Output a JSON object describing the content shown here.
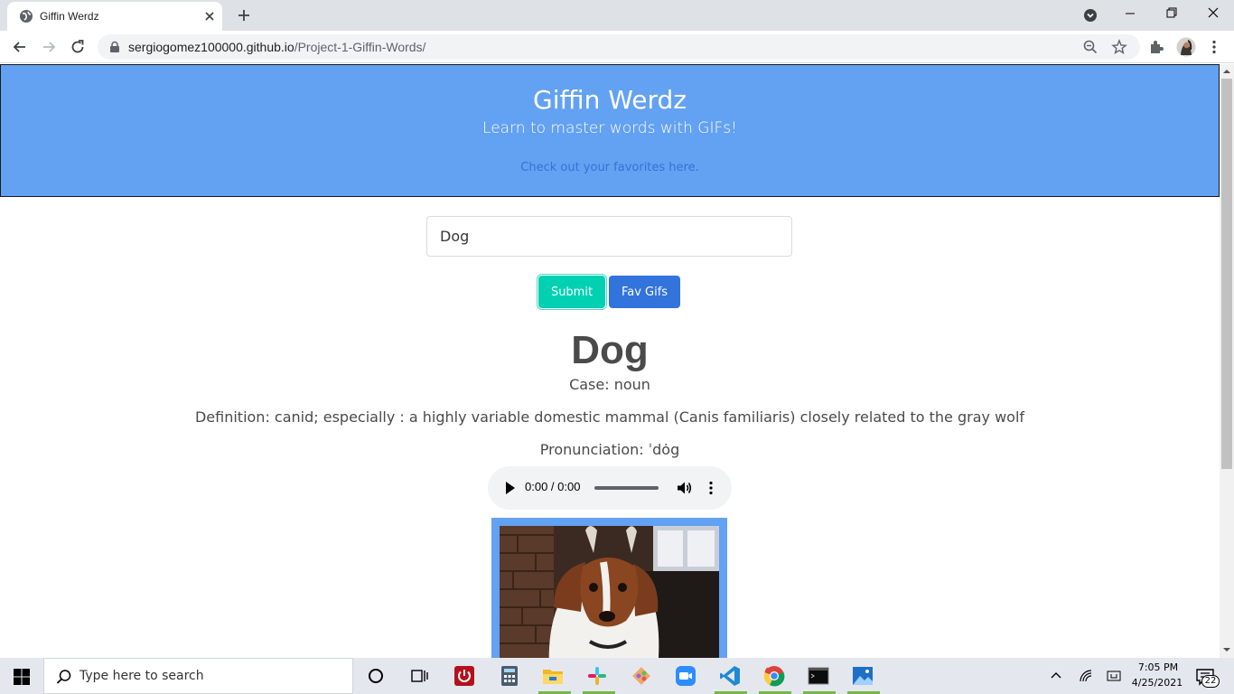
{
  "browser": {
    "tab": {
      "title": "Giffin Werdz"
    },
    "url": {
      "host": "sergiogomez100000.github.io",
      "path": "/Project-1-Giffin-Words/"
    }
  },
  "hero": {
    "title": "Giffin Werdz",
    "subtitle": "Learn to master words with GIFs!",
    "favorites_link": "Check out your favorites here."
  },
  "search": {
    "value": "Dog"
  },
  "buttons": {
    "submit": "Submit",
    "fav": "Fav Gifs"
  },
  "result": {
    "word": "Dog",
    "case": "Case: noun",
    "definition": "Definition: canid; especially : a highly variable domestic mammal (Canis familiaris) closely related to the gray wolf",
    "pronunciation": "Pronunciation: ˈdȯg",
    "audio_time": "0:00 / 0:00"
  },
  "colors": {
    "hero": "#63a1f2",
    "submit": "#00d1b2",
    "fav": "#3273dc"
  },
  "taskbar": {
    "search_placeholder": "Type here to search",
    "time": "7:05 PM",
    "date": "4/25/2021",
    "notifications": "22",
    "apps": [
      "cortana-icon",
      "task-view-icon",
      "power-app-icon",
      "calculator-icon",
      "file-explorer-icon",
      "slack-icon",
      "git-icon",
      "zoom-icon",
      "vscode-icon",
      "chrome-icon",
      "terminal-icon",
      "photos-icon"
    ]
  }
}
